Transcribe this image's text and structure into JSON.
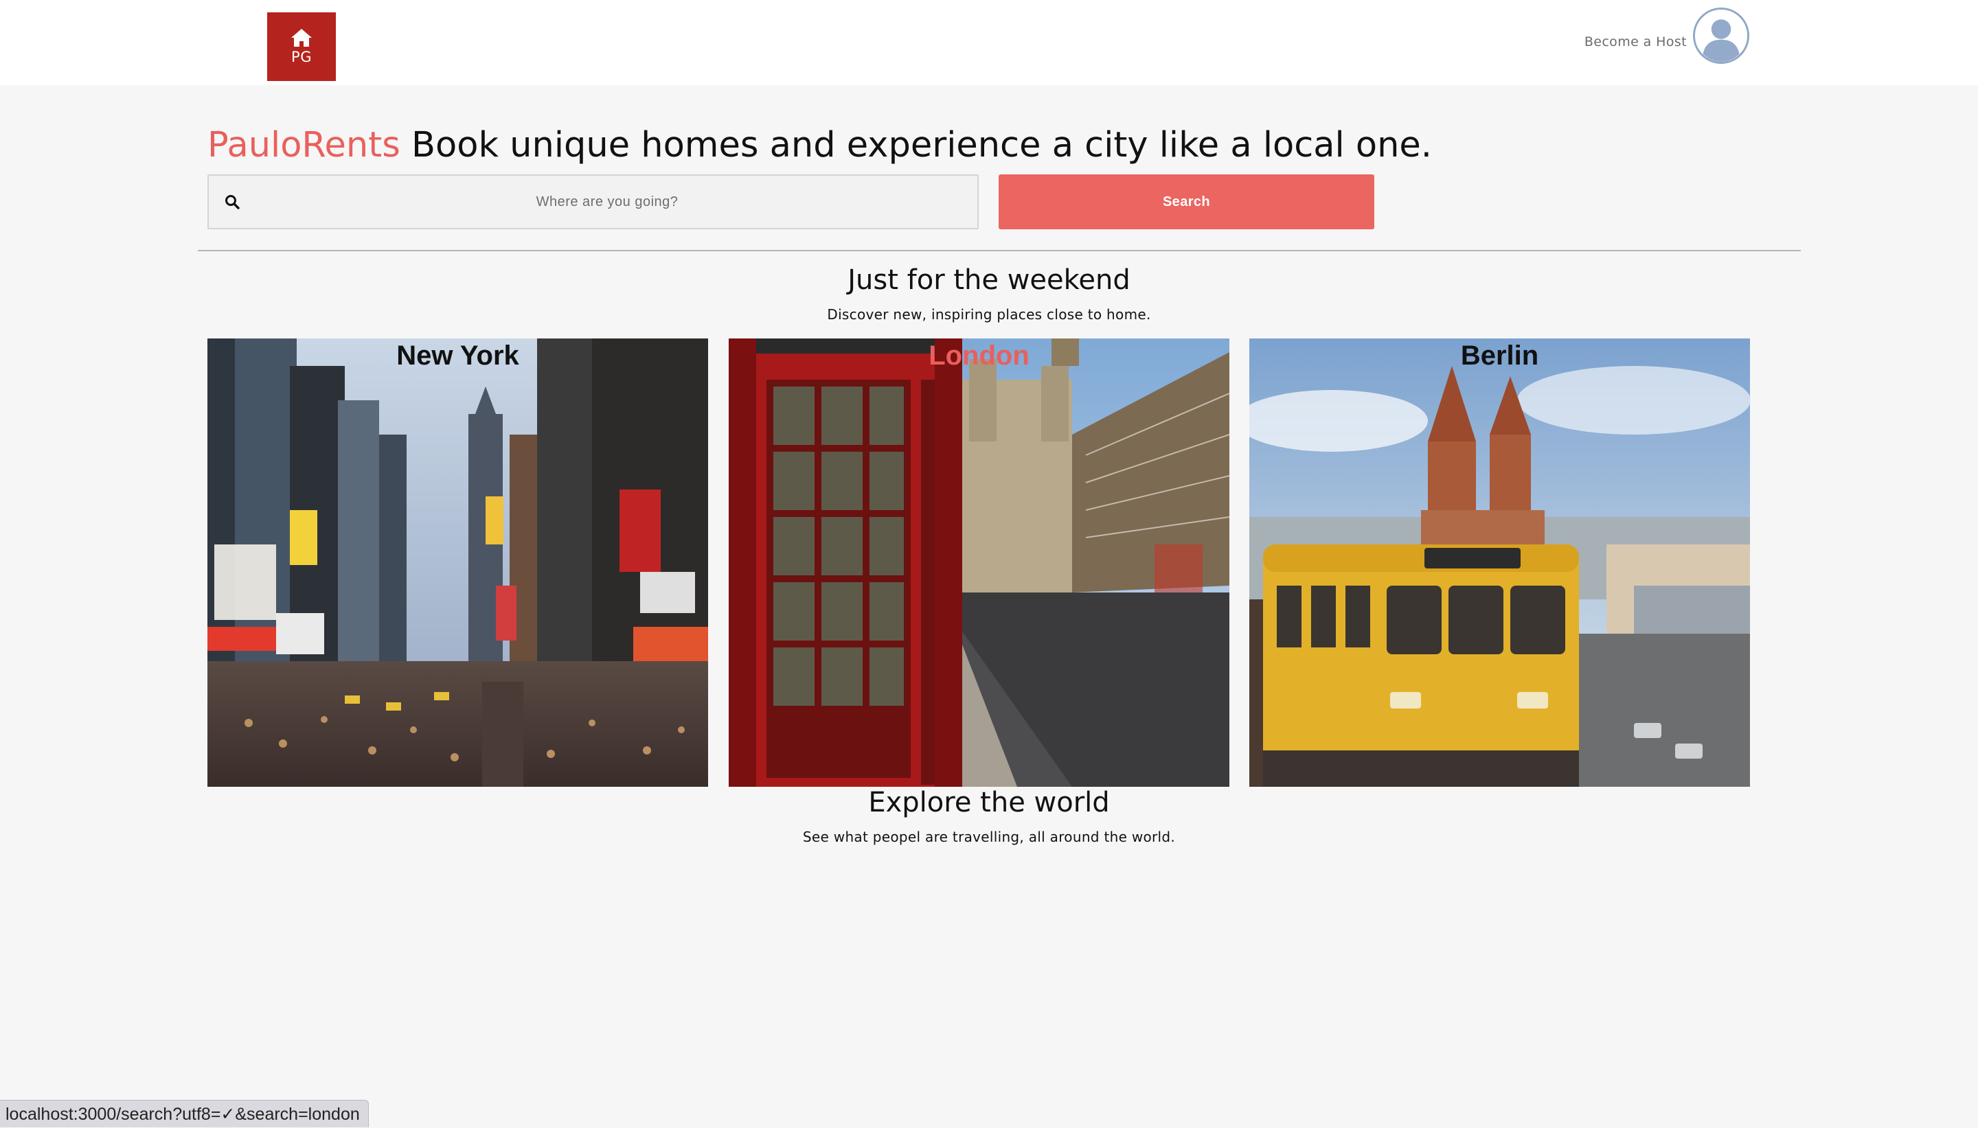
{
  "header": {
    "logo_text": "PG",
    "become_host_label": "Become a Host"
  },
  "hero": {
    "brand": "PauloRents",
    "tagline": "Book unique homes and experience a city like a local one.",
    "search_placeholder": "Where are you going?",
    "search_button_label": "Search"
  },
  "weekend": {
    "title": "Just for the weekend",
    "subtitle": "Discover new, inspiring places close to home.",
    "cities": [
      {
        "name": "New York"
      },
      {
        "name": "London"
      },
      {
        "name": "Berlin"
      }
    ]
  },
  "explore": {
    "title": "Explore the world",
    "subtitle": "See what peopel are travelling, all around the world."
  },
  "status_bar": {
    "url": "localhost:3000/search?utf8=✓&search=london"
  },
  "colors": {
    "brand": "#e8605d",
    "logo_bg": "#b5231f",
    "search_button": "#eb6561",
    "page_bg": "#f6f6f6"
  },
  "icons": {
    "logo": "home-icon",
    "search": "search-icon",
    "avatar": "user-avatar-icon"
  }
}
